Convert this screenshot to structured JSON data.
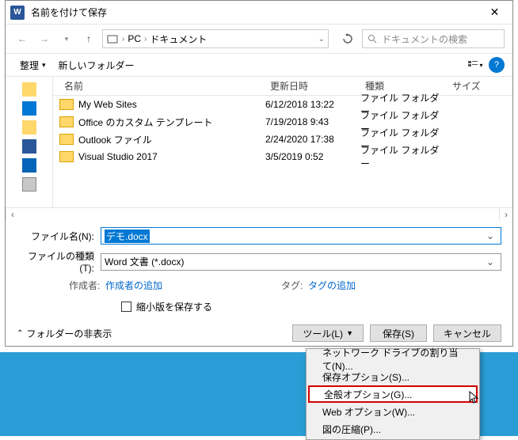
{
  "titlebar": {
    "title": "名前を付けて保存"
  },
  "nav": {
    "crumbs": [
      "PC",
      "ドキュメント"
    ],
    "search_placeholder": "ドキュメントの検索"
  },
  "toolbar": {
    "organize": "整理",
    "newfolder": "新しいフォルダー"
  },
  "filehdr": {
    "name": "名前",
    "date": "更新日時",
    "type": "種類",
    "size": "サイズ"
  },
  "files": [
    {
      "name": "My Web Sites",
      "date": "6/12/2018 13:22",
      "type": "ファイル フォルダー"
    },
    {
      "name": "Office のカスタム テンプレート",
      "date": "7/19/2018 9:43",
      "type": "ファイル フォルダー"
    },
    {
      "name": "Outlook ファイル",
      "date": "2/24/2020 17:38",
      "type": "ファイル フォルダー"
    },
    {
      "name": "Visual Studio 2017",
      "date": "3/5/2019 0:52",
      "type": "ファイル フォルダー"
    }
  ],
  "form": {
    "filename_label": "ファイル名(N):",
    "filename_value": "デモ.docx",
    "filetype_label": "ファイルの種類(T):",
    "filetype_value": "Word 文書 (*.docx)",
    "author_label": "作成者:",
    "author_link": "作成者の追加",
    "tag_label": "タグ:",
    "tag_link": "タグの追加",
    "thumbnail_check": "縮小版を保存する"
  },
  "buttons": {
    "hide_folders": "フォルダーの非表示",
    "tools": "ツール(L)",
    "save": "保存(S)",
    "cancel": "キャンセル"
  },
  "menu": {
    "items": [
      "ネットワーク ドライブの割り当て(N)...",
      "保存オプション(S)...",
      "全般オプション(G)...",
      "Web オプション(W)...",
      "図の圧縮(P)..."
    ]
  }
}
